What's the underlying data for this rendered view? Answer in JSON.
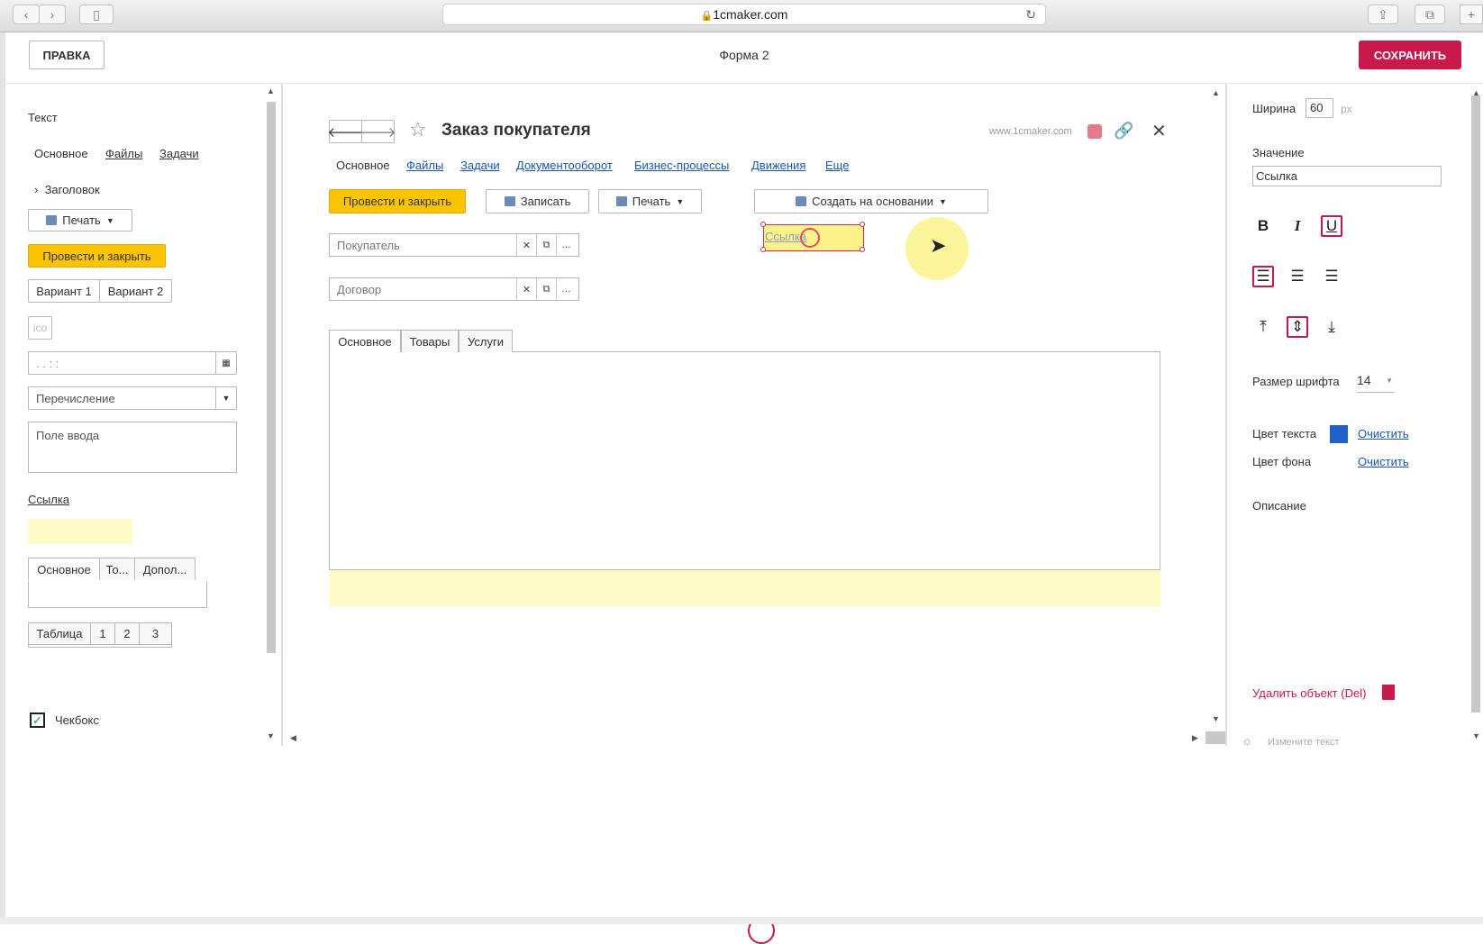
{
  "browser": {
    "url": "1cmaker.com"
  },
  "topbar": {
    "help_label": "ПРАВКА",
    "form_title": "Форма 2",
    "save_label": "СОХРАНИТЬ"
  },
  "palette": {
    "text": "Текст",
    "tabs": [
      "Основное",
      "Файлы",
      "Задачи"
    ],
    "heading": "Заголовок",
    "print": "Печать",
    "post_close": "Провести и закрыть",
    "variants": [
      "Вариант 1",
      "Вариант 2"
    ],
    "ico": "ico",
    "date_placeholder": ". . : :",
    "enum": "Перечисление",
    "input_field": "Поле ввода",
    "link": "Ссылка",
    "tabset": [
      "Основное",
      "То...",
      "Допол..."
    ],
    "table": [
      "Таблица",
      "1",
      "2",
      "3"
    ],
    "checkbox": "Чекбокс"
  },
  "form": {
    "title": "Заказ покупателя",
    "site": "www.1cmaker.com",
    "nav": [
      "Основное",
      "Файлы",
      "Задачи",
      "Документооборот",
      "Бизнес-процессы",
      "Движения",
      "Еще"
    ],
    "toolbar": {
      "post_close": "Провести и закрыть",
      "write": "Записать",
      "print": "Печать",
      "create_based": "Создать на основании"
    },
    "selected_link": "Ссылка",
    "fields": [
      {
        "label": "Покупатель"
      },
      {
        "label": "Договор"
      }
    ],
    "tabs": [
      "Основное",
      "Товары",
      "Услуги"
    ]
  },
  "props": {
    "width_label": "Ширина",
    "width_value": "60",
    "width_unit": "px",
    "value_label": "Значение",
    "value": "Ссылка",
    "font_size_label": "Размер шрифта",
    "font_size": "14",
    "text_color_label": "Цвет текста",
    "text_color": "#1f5fc8",
    "clear_label": "Очистить",
    "bg_color_label": "Цвет фона",
    "description_label": "Описание",
    "delete_label": "Удалить объект (Del)",
    "hint": "Измените текст"
  },
  "colors": {
    "accent": "#c9184a",
    "yellow_button": "#fbc300",
    "link": "#1a56b8"
  }
}
